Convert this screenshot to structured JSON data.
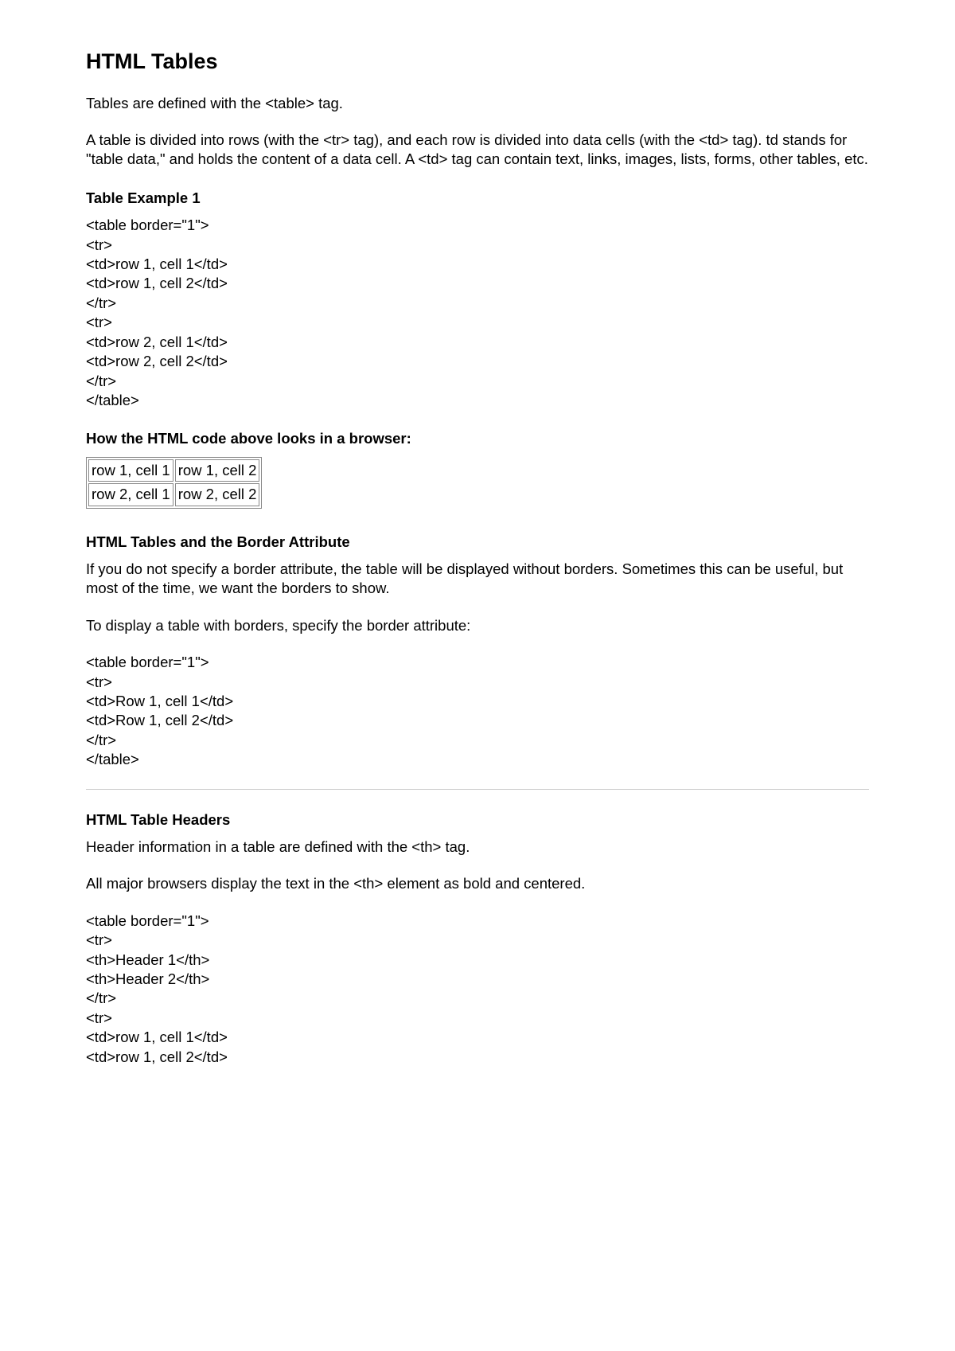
{
  "title": "HTML Tables",
  "intro1": "Tables are defined with the <table> tag.",
  "intro2": "A table is divided into rows (with the <tr> tag), and each row is divided into data cells (with the <td> tag). td stands for \"table data,\" and holds the content of a data cell. A <td> tag can contain text, links, images, lists, forms, other tables, etc.",
  "example1_heading": "Table Example 1",
  "example1_code": [
    "<table border=\"1\">",
    "<tr>",
    "<td>row 1, cell 1</td>",
    "<td>row 1, cell 2</td>",
    "</tr>",
    "<tr>",
    "<td>row 2, cell 1</td>",
    "<td>row 2, cell 2</td>",
    "</tr>",
    "</table>"
  ],
  "browser_heading": "How the HTML code above looks in a browser:",
  "render_table": {
    "rows": [
      [
        "row 1, cell 1",
        "row 1, cell 2"
      ],
      [
        "row 2, cell 1",
        "row 2, cell 2"
      ]
    ]
  },
  "border_heading": "HTML Tables and the Border Attribute",
  "border_p1": "If you do not specify a border attribute, the table will be displayed without borders. Sometimes this can be useful, but most of the time, we want the borders to show.",
  "border_p2": "To display a table with borders, specify the border attribute:",
  "border_code": [
    "<table border=\"1\">",
    "<tr>",
    "<td>Row 1, cell 1</td>",
    "<td>Row 1, cell 2</td>",
    "</tr>",
    "</table>"
  ],
  "headers_heading": "HTML Table Headers",
  "headers_p1": "Header information in a table are defined with the <th> tag.",
  "headers_p2": "All major browsers display the text in the <th> element as bold and centered.",
  "headers_code": [
    "<table border=\"1\">",
    "<tr>",
    "<th>Header 1</th>",
    "<th>Header 2</th>",
    "</tr>",
    "<tr>",
    "<td>row 1, cell 1</td>",
    "<td>row 1, cell 2</td>"
  ]
}
